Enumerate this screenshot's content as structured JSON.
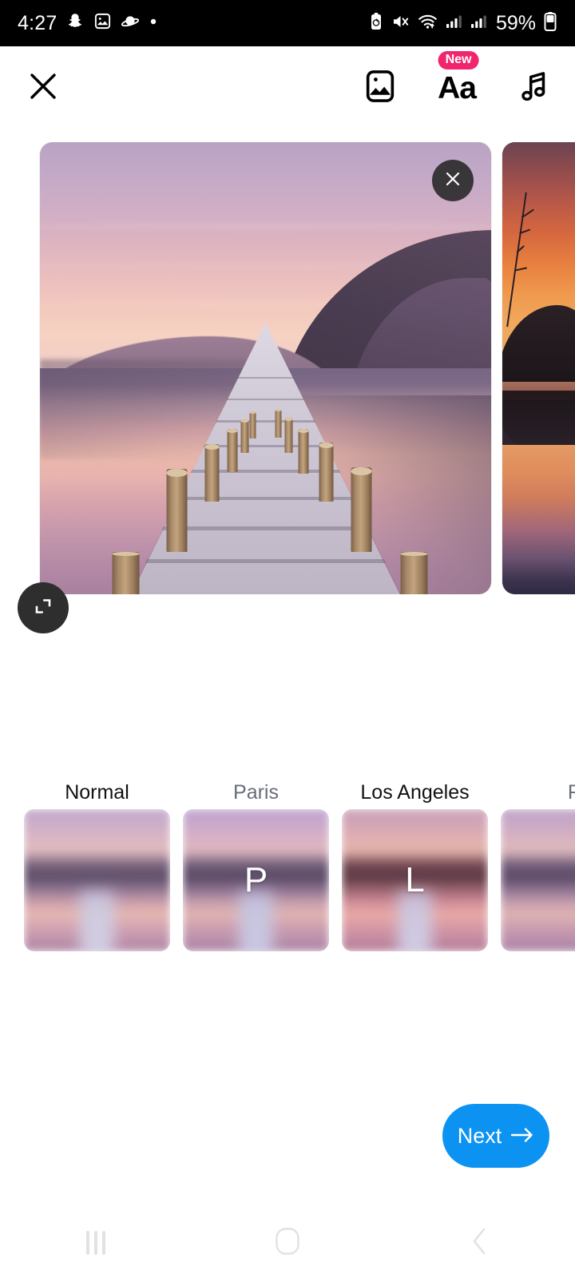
{
  "status_bar": {
    "time": "4:27",
    "battery_percent": "59%",
    "left_icons": [
      "snapchat-ghost-icon",
      "photos-icon",
      "saturn-icon",
      "dot-icon"
    ],
    "right_icons": [
      "battery-saver-icon",
      "mute-vibrate-icon",
      "wifi-icon",
      "signal-sim1-icon",
      "signal-sim2-icon",
      "battery-icon"
    ]
  },
  "toolbar": {
    "close_label": "",
    "close_icon": "close-icon",
    "actions": [
      {
        "name": "photo-sticker-icon",
        "badge": ""
      },
      {
        "name": "text-tool-icon",
        "label": "Aa",
        "badge": "New"
      },
      {
        "name": "music-note-icon",
        "badge": ""
      }
    ]
  },
  "carousel": {
    "main_card": {
      "alt": "Pink purple sunset lake with wooden jetty",
      "close_icon": "close-icon"
    },
    "next_card": {
      "alt": "Orange sunset over dark hill with reflection"
    },
    "expand_icon": "expand-crop-icon"
  },
  "filters": {
    "items": [
      {
        "label": "Normal",
        "letter": "",
        "selected": true,
        "thumb": "thumb-normal"
      },
      {
        "label": "Paris",
        "letter": "P",
        "selected": false,
        "thumb": "thumb-paris"
      },
      {
        "label": "Los Angeles",
        "letter": "L",
        "selected": false,
        "thumb": "thumb-la"
      },
      {
        "label": "F",
        "letter": "",
        "selected": false,
        "thumb": "thumb-f"
      }
    ]
  },
  "next_button": {
    "label": "Next",
    "icon": "arrow-right-icon",
    "color": "#0c93f2"
  },
  "nav_bar": {
    "recents_label": "recents-icon",
    "home_label": "home-icon",
    "back_label": "back-icon"
  }
}
